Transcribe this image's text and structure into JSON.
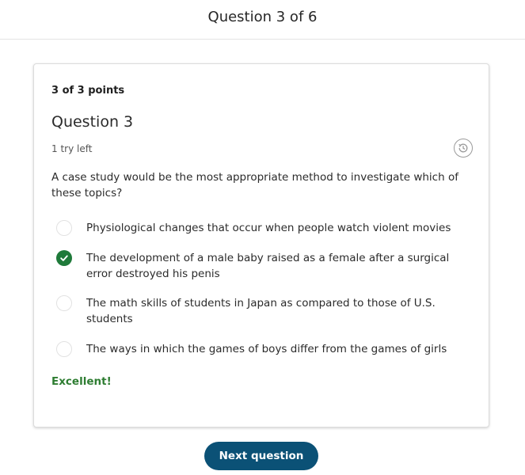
{
  "header": {
    "title": "Question 3 of 6"
  },
  "question": {
    "points": "3 of 3 points",
    "title": "Question 3",
    "tries": "1 try left",
    "text": "A case study would be the most appropriate method to investigate which of these topics?",
    "options": [
      {
        "label": "Physiological changes that occur when people watch violent movies",
        "selected": false
      },
      {
        "label": "The development of a male baby raised as a female after a surgical error destroyed his penis",
        "selected": true
      },
      {
        "label": "The math skills of students in Japan as compared to those of U.S. students",
        "selected": false
      },
      {
        "label": "The ways in which the games of boys differ from the games of girls",
        "selected": false
      }
    ],
    "feedback": "Excellent!"
  },
  "footer": {
    "next_label": "Next question"
  },
  "colors": {
    "correct": "#1f7a3a",
    "feedback": "#2e7d32",
    "button": "#0b5176"
  },
  "icons": {
    "history": "history-icon",
    "check": "checkmark-icon"
  }
}
